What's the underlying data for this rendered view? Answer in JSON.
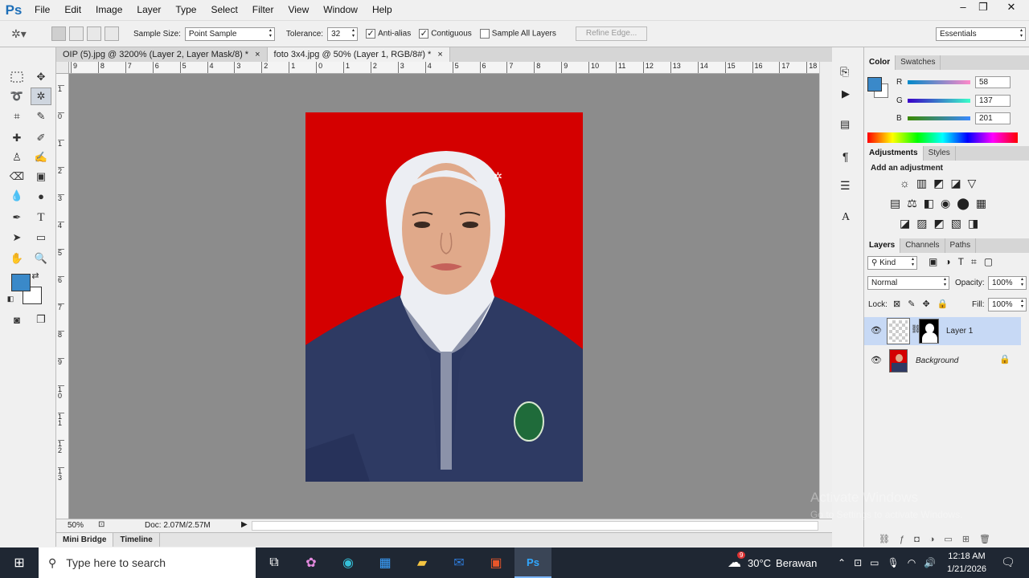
{
  "app": {
    "logo": "Ps"
  },
  "menu": [
    "File",
    "Edit",
    "Image",
    "Layer",
    "Type",
    "Select",
    "Filter",
    "View",
    "Window",
    "Help"
  ],
  "window_controls": {
    "minimize": "–",
    "restore": "❐",
    "close": "✕"
  },
  "options": {
    "sample_size_label": "Sample Size:",
    "sample_size_value": "Point Sample",
    "tolerance_label": "Tolerance:",
    "tolerance_value": "32",
    "anti_alias_label": "Anti-alias",
    "contiguous_label": "Contiguous",
    "sample_all_label": "Sample All Layers",
    "refine_edge_label": "Refine Edge...",
    "workspace": "Essentials"
  },
  "doc_tabs": [
    {
      "label": "OIP (5).jpg @ 3200% (Layer 2, Layer Mask/8) *",
      "close": "×"
    },
    {
      "label": "foto 3x4.jpg @ 50% (Layer 1, RGB/8#) *",
      "close": "×"
    }
  ],
  "ruler_h": [
    "9",
    "8",
    "7",
    "6",
    "5",
    "4",
    "3",
    "2",
    "1",
    "0",
    "1",
    "2",
    "3",
    "4",
    "5",
    "6",
    "7",
    "8",
    "9",
    "10",
    "11",
    "12",
    "13",
    "14",
    "15",
    "16",
    "17",
    "18"
  ],
  "ruler_v": [
    "1",
    "0",
    "1",
    "2",
    "3",
    "4",
    "5",
    "6",
    "7",
    "8",
    "9",
    "10",
    "11",
    "12",
    "13"
  ],
  "status": {
    "zoom": "50%",
    "doc": "Doc: 2.07M/2.57M"
  },
  "bottom_tabs": [
    "Mini Bridge",
    "Timeline"
  ],
  "color_panel": {
    "tabs": [
      "Color",
      "Swatches"
    ],
    "r_label": "R",
    "r": "58",
    "g_label": "G",
    "g": "137",
    "b_label": "B",
    "b": "201",
    "foreground": "#3a89c9"
  },
  "adjustments": {
    "tabs": [
      "Adjustments",
      "Styles"
    ],
    "title": "Add an adjustment"
  },
  "layers_panel": {
    "tabs": [
      "Layers",
      "Channels",
      "Paths"
    ],
    "filter": "Kind",
    "blend_mode": "Normal",
    "opacity_label": "Opacity:",
    "opacity": "100%",
    "lock_label": "Lock:",
    "fill_label": "Fill:",
    "fill": "100%",
    "layers": [
      {
        "name": "Layer 1",
        "selected": true
      },
      {
        "name": "Background",
        "selected": false
      }
    ]
  },
  "watermark": {
    "line1": "Activate Windows",
    "line2": "Go to Settings to activate Windows."
  },
  "taskbar": {
    "search_placeholder": "Type here to search",
    "weather_badge": "9",
    "temp": "30°C",
    "weather": "Berawan",
    "time": "12:18 AM",
    "date": "1/21/2026"
  }
}
